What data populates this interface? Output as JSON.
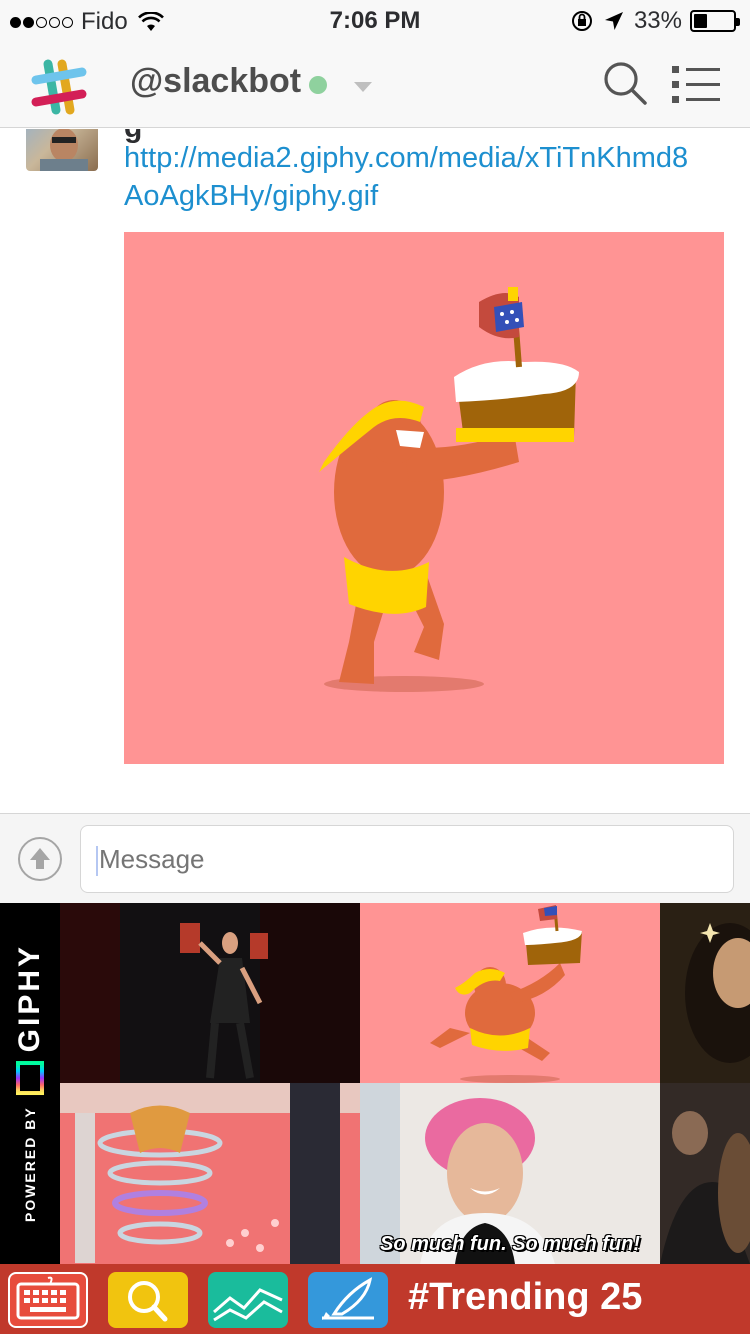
{
  "status_bar": {
    "carrier": "Fido",
    "time": "7:06 PM",
    "battery": "33%",
    "battery_level": 0.33,
    "signal_bars": 2
  },
  "header": {
    "channel": "@slackbot",
    "presence": "online",
    "icons": [
      "slack-logo-icon",
      "search-icon",
      "list-icon"
    ]
  },
  "message": {
    "author_partial": "g",
    "link": "http://media2.giphy.com/media/xTiTnKhmd8AoAgkBHy/giphy.gif",
    "gif_background": "#ff9494"
  },
  "composer": {
    "placeholder": "Message"
  },
  "giphy_panel": {
    "powered_by": "POWERED BY",
    "brand": "GIPHY",
    "tiles": [
      {
        "name": "dancing-man-gif"
      },
      {
        "name": "cake-runner-gif"
      },
      {
        "name": "partial-gif-top-right"
      },
      {
        "name": "spinning-tornado-gif"
      },
      {
        "name": "pink-hair-woman-gif",
        "caption": "So much fun. So much fun!"
      },
      {
        "name": "partial-gif-bottom-right"
      }
    ]
  },
  "toolbar": {
    "trending_label": "#Trending 25",
    "buttons": [
      {
        "name": "keyboard-icon",
        "color": "#e74c3c"
      },
      {
        "name": "search-icon",
        "color": "#f1c40f"
      },
      {
        "name": "trending-chart-icon",
        "color": "#1abc9c"
      },
      {
        "name": "compose-icon",
        "color": "#3498db"
      }
    ],
    "background": "#c0392b"
  }
}
